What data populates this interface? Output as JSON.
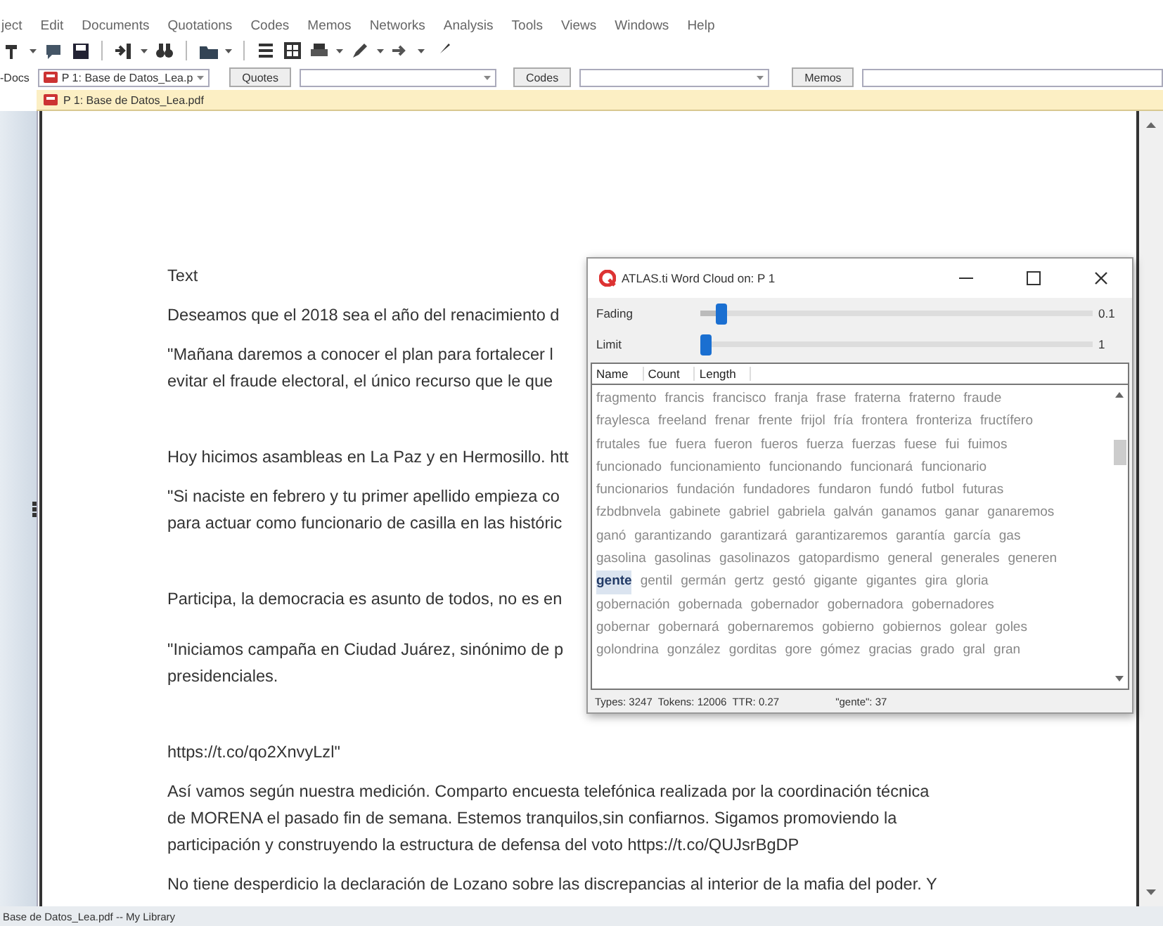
{
  "menu": [
    "ject",
    "Edit",
    "Documents",
    "Quotations",
    "Codes",
    "Memos",
    "Networks",
    "Analysis",
    "Tools",
    "Views",
    "Windows",
    "Help"
  ],
  "filter_bar": {
    "docs_label": "-Docs",
    "document_combo": "P 1: Base de Datos_Lea.p",
    "quotes_button": "Quotes",
    "codes_button": "Codes",
    "memos_button": "Memos"
  },
  "document_tab": {
    "title": "P 1: Base de Datos_Lea.pdf"
  },
  "document": {
    "paragraphs": [
      {
        "lines": [
          "Text"
        ]
      },
      {
        "lines": [
          "Deseamos que el 2018 sea el año del renacimiento d"
        ]
      },
      {
        "lines": [
          "\"Mañana daremos a conocer el plan para fortalecer l",
          "evitar el fraude electoral, el único recurso que le que"
        ]
      },
      {
        "lines": [
          "Hoy hicimos asambleas en La Paz y en Hermosillo. htt"
        ]
      },
      {
        "lines": [
          "\"Si naciste en febrero y tu primer apellido empieza co",
          "para actuar como funcionario de casilla en las históric"
        ]
      },
      {
        "lines": [
          "Participa, la democracia es asunto de todos, no es en"
        ]
      },
      {
        "lines": [
          "\"Iniciamos campaña en Ciudad Juárez, sinónimo de p",
          "presidenciales."
        ]
      },
      {
        "lines": [
          "https://t.co/qo2XnvyLzl\""
        ]
      },
      {
        "lines": [
          "Así vamos según nuestra medición. Comparto encuesta telefónica realizada por la coordinación técnica",
          "de MORENA el pasado fin de semana. Estemos tranquilos,sin confiarnos. Sigamos promoviendo la",
          "participación y construyendo la estructura de defensa del voto https://t.co/QUJsrBgDP"
        ]
      },
      {
        "lines": [
          "No tiene desperdicio la declaración de Lozano sobre las discrepancias al interior de la mafia del poder. Y"
        ]
      }
    ]
  },
  "word_cloud": {
    "title": "ATLAS.ti Word Cloud on: P 1",
    "sliders": [
      {
        "label": "Fading",
        "level": 0.04,
        "reading": "0.1"
      },
      {
        "label": "Limit",
        "level": 0,
        "reading": "1"
      }
    ],
    "columns": [
      "Name",
      "Count",
      "Length"
    ],
    "rows": [
      [
        {
          "text": "fragmento",
          "selected": false
        },
        {
          "text": "francis",
          "selected": false
        },
        {
          "text": "francisco",
          "selected": false
        },
        {
          "text": "franja",
          "selected": false
        },
        {
          "text": "frase",
          "selected": false
        },
        {
          "text": "fraterna",
          "selected": false
        },
        {
          "text": "fraterno",
          "selected": false
        },
        {
          "text": "fraude",
          "selected": false
        }
      ],
      [
        {
          "text": "fraylesca",
          "selected": false
        },
        {
          "text": "freeland",
          "selected": false
        },
        {
          "text": "frenar",
          "selected": false
        },
        {
          "text": "frente",
          "selected": false
        },
        {
          "text": "frijol",
          "selected": false
        },
        {
          "text": "fría",
          "selected": false
        },
        {
          "text": "frontera",
          "selected": false
        },
        {
          "text": "fronteriza",
          "selected": false
        },
        {
          "text": "fructífero",
          "selected": false
        }
      ],
      [
        {
          "text": "frutales",
          "selected": false
        },
        {
          "text": "fue",
          "selected": false
        },
        {
          "text": "fuera",
          "selected": false
        },
        {
          "text": "fueron",
          "selected": false
        },
        {
          "text": "fueros",
          "selected": false
        },
        {
          "text": "fuerza",
          "selected": false
        },
        {
          "text": "fuerzas",
          "selected": false
        },
        {
          "text": "fuese",
          "selected": false
        },
        {
          "text": "fui",
          "selected": false
        },
        {
          "text": "fuimos",
          "selected": false
        }
      ],
      [
        {
          "text": "funcionado",
          "selected": false
        },
        {
          "text": "funcionamiento",
          "selected": false
        },
        {
          "text": "funcionando",
          "selected": false
        },
        {
          "text": "funcionará",
          "selected": false
        },
        {
          "text": "funcionario",
          "selected": false
        }
      ],
      [
        {
          "text": "funcionarios",
          "selected": false
        },
        {
          "text": "fundación",
          "selected": false
        },
        {
          "text": "fundadores",
          "selected": false
        },
        {
          "text": "fundaron",
          "selected": false
        },
        {
          "text": "fundó",
          "selected": false
        },
        {
          "text": "futbol",
          "selected": false
        },
        {
          "text": "futuras",
          "selected": false
        }
      ],
      [
        {
          "text": "fzbdbnvela",
          "selected": false
        },
        {
          "text": "gabinete",
          "selected": false
        },
        {
          "text": "gabriel",
          "selected": false
        },
        {
          "text": "gabriela",
          "selected": false
        },
        {
          "text": "galván",
          "selected": false
        },
        {
          "text": "ganamos",
          "selected": false
        },
        {
          "text": "ganar",
          "selected": false
        },
        {
          "text": "ganaremos",
          "selected": false
        }
      ],
      [
        {
          "text": "ganó",
          "selected": false
        },
        {
          "text": "garantizando",
          "selected": false
        },
        {
          "text": "garantizará",
          "selected": false
        },
        {
          "text": "garantizaremos",
          "selected": false
        },
        {
          "text": "garantía",
          "selected": false
        },
        {
          "text": "garcía",
          "selected": false
        },
        {
          "text": "gas",
          "selected": false
        }
      ],
      [
        {
          "text": "gasolina",
          "selected": false
        },
        {
          "text": "gasolinas",
          "selected": false
        },
        {
          "text": "gasolinazos",
          "selected": false
        },
        {
          "text": "gatopardismo",
          "selected": false
        },
        {
          "text": "general",
          "selected": false
        },
        {
          "text": "generales",
          "selected": false
        },
        {
          "text": "generen",
          "selected": false
        }
      ],
      [
        {
          "text": "gente",
          "selected": true
        },
        {
          "text": "gentil",
          "selected": false
        },
        {
          "text": "germán",
          "selected": false
        },
        {
          "text": "gertz",
          "selected": false
        },
        {
          "text": "gestó",
          "selected": false
        },
        {
          "text": "gigante",
          "selected": false
        },
        {
          "text": "gigantes",
          "selected": false
        },
        {
          "text": "gira",
          "selected": false
        },
        {
          "text": "gloria",
          "selected": false
        }
      ],
      [
        {
          "text": "gobernación",
          "selected": false
        },
        {
          "text": "gobernada",
          "selected": false
        },
        {
          "text": "gobernador",
          "selected": false
        },
        {
          "text": "gobernadora",
          "selected": false
        },
        {
          "text": "gobernadores",
          "selected": false
        }
      ],
      [
        {
          "text": "gobernar",
          "selected": false
        },
        {
          "text": "gobernará",
          "selected": false
        },
        {
          "text": "gobernaremos",
          "selected": false
        },
        {
          "text": "gobierno",
          "selected": false
        },
        {
          "text": "gobiernos",
          "selected": false
        },
        {
          "text": "golear",
          "selected": false
        },
        {
          "text": "goles",
          "selected": false
        }
      ],
      [
        {
          "text": "golondrina",
          "selected": false
        },
        {
          "text": "gonzález",
          "selected": false
        },
        {
          "text": "gorditas",
          "selected": false
        },
        {
          "text": "gore",
          "selected": false
        },
        {
          "text": "gómez",
          "selected": false
        },
        {
          "text": "gracias",
          "selected": false
        },
        {
          "text": "grado",
          "selected": false
        },
        {
          "text": "gral",
          "selected": false
        },
        {
          "text": "gran",
          "selected": false
        }
      ]
    ],
    "stats": "Types: 3247  Tokens: 12006  TTR: 0.27",
    "selection_count": "\"gente\": 37"
  },
  "status_bar": {
    "path": "Base de Datos_Lea.pdf -- My Library"
  }
}
